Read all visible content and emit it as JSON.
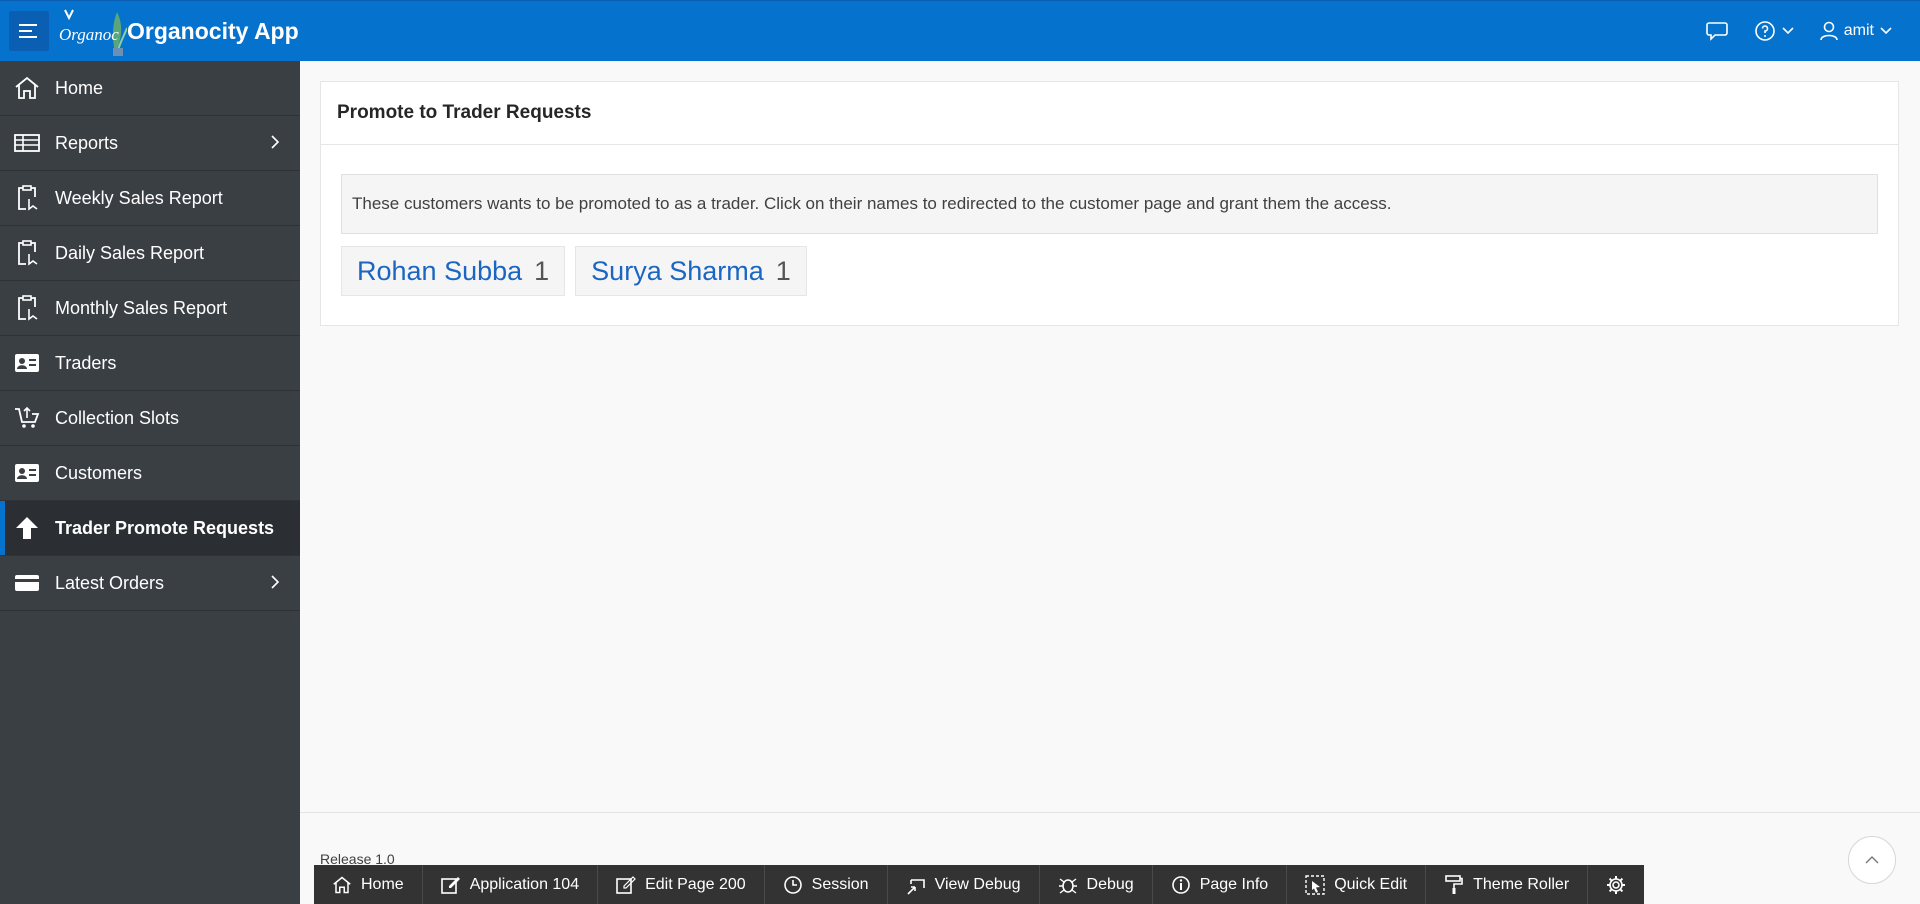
{
  "header": {
    "logo_text": "Organoc",
    "app_title": "Organocity App",
    "user_name": "amit"
  },
  "sidebar": {
    "items": [
      {
        "label": "Home",
        "icon": "home-icon",
        "has_children": false
      },
      {
        "label": "Reports",
        "icon": "table-icon",
        "has_children": true
      },
      {
        "label": "Weekly Sales Report",
        "icon": "clipboard-icon",
        "has_children": false
      },
      {
        "label": "Daily Sales Report",
        "icon": "clipboard-icon",
        "has_children": false
      },
      {
        "label": "Monthly Sales Report",
        "icon": "clipboard-icon",
        "has_children": false
      },
      {
        "label": "Traders",
        "icon": "id-card-icon",
        "has_children": false
      },
      {
        "label": "Collection Slots",
        "icon": "cart-icon",
        "has_children": false
      },
      {
        "label": "Customers",
        "icon": "id-card-icon",
        "has_children": false
      },
      {
        "label": "Trader Promote Requests",
        "icon": "arrow-up-icon",
        "has_children": false,
        "active": true
      },
      {
        "label": "Latest Orders",
        "icon": "credit-card-icon",
        "has_children": true
      }
    ]
  },
  "main": {
    "region_title": "Promote to Trader Requests",
    "info_text": "These customers wants to be promoted to as a trader. Click on their names to redirected to the customer page and grant them the access.",
    "badges": [
      {
        "name": "Rohan Subba",
        "count": "1"
      },
      {
        "name": "Surya Sharma",
        "count": "1"
      }
    ]
  },
  "footer": {
    "release": "Release 1.0"
  },
  "devbar": {
    "items": [
      {
        "label": "Home",
        "icon": "home-icon"
      },
      {
        "label": "Application 104",
        "icon": "edit-icon"
      },
      {
        "label": "Edit Page 200",
        "icon": "edit-icon"
      },
      {
        "label": "Session",
        "icon": "clock-icon"
      },
      {
        "label": "View Debug",
        "icon": "view-debug-icon"
      },
      {
        "label": "Debug",
        "icon": "bug-icon"
      },
      {
        "label": "Page Info",
        "icon": "info-icon"
      },
      {
        "label": "Quick Edit",
        "icon": "quick-edit-icon"
      },
      {
        "label": "Theme Roller",
        "icon": "paint-roller-icon"
      }
    ]
  },
  "colors": {
    "header_bg": "#0572ce",
    "sidebar_bg": "#3a3f44",
    "link": "#1a66c2"
  }
}
